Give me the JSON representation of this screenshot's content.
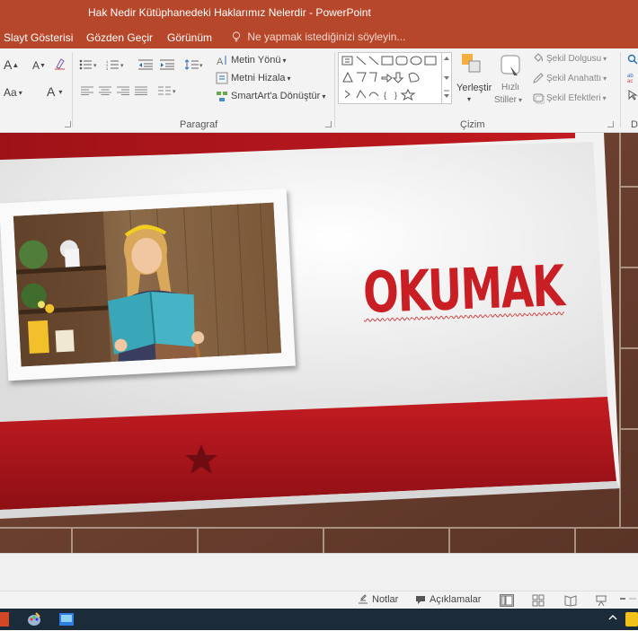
{
  "window": {
    "title": "Hak Nedir Kütüphanedeki Haklarımız Nelerdir - PowerPoint"
  },
  "menu": {
    "tabs": [
      "Slayt Gösterisi",
      "Gözden Geçir",
      "Görünüm"
    ],
    "tell_me": "Ne yapmak istediğinizi söyleyin..."
  },
  "ribbon": {
    "font_group": {
      "grow": "A",
      "shrink": "A",
      "case": "Aa",
      "color": "A"
    },
    "paragraph": {
      "label": "Paragraf",
      "text_direction": "Metin Yönü",
      "align_text": "Metni Hizala",
      "smartart": "SmartArt'a Dönüştür"
    },
    "drawing": {
      "label": "Çizim",
      "arrange": "Yerleştir",
      "quick_styles_1": "Hızlı",
      "quick_styles_2": "Stiller",
      "shape_fill": "Şekil Dolgusu",
      "shape_outline": "Şekil Anahattı",
      "shape_effects": "Şekil Efektleri"
    },
    "right_group_letter": "D"
  },
  "slide": {
    "title": "OKUMAK",
    "photo_description_icon": "girl-reading-photo"
  },
  "status": {
    "notes": "Notlar",
    "comments": "Açıklamalar"
  },
  "colors": {
    "accent": "#b7472a",
    "slide_red": "#b0141c",
    "title_red": "#c81e24"
  }
}
